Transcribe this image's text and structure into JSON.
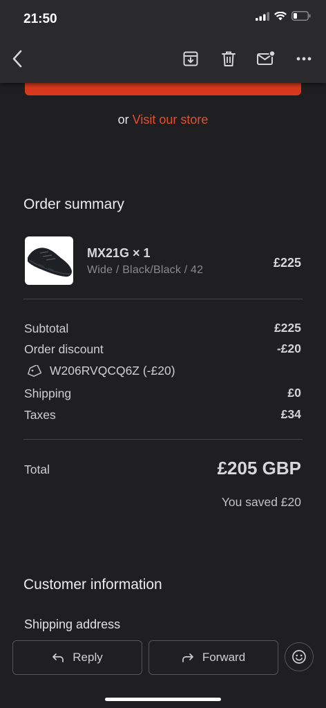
{
  "status_bar": {
    "time": "21:50"
  },
  "toolbar": {
    "back_icon": "chevron-left-icon",
    "archive_icon": "archive-icon",
    "delete_icon": "trash-icon",
    "unread_icon": "mail-unread-icon",
    "more_icon": "more-horizontal-icon"
  },
  "email": {
    "store_prefix": "or ",
    "store_link": "Visit our store",
    "order_summary_title": "Order summary",
    "product": {
      "name": "MX21G × 1",
      "variant": "Wide / Black/Black / 42",
      "price": "£225"
    },
    "totals": {
      "subtotal_label": "Subtotal",
      "subtotal_value": "£225",
      "discount_label": "Order discount",
      "discount_value": "-£20",
      "discount_code": "W206RVQCQ6Z (-£20)",
      "shipping_label": "Shipping",
      "shipping_value": "£0",
      "taxes_label": "Taxes",
      "taxes_value": "£34",
      "total_label": "Total",
      "total_value": "£205 GBP",
      "saved": "You saved £20"
    },
    "customer_info_title": "Customer information",
    "shipping_address_title": "Shipping address"
  },
  "actions": {
    "reply_label": "Reply",
    "forward_label": "Forward",
    "emoji_icon": "smiley-icon"
  },
  "colors": {
    "accent": "#d8391e",
    "link": "#e2502f",
    "background": "#1f1f21"
  }
}
